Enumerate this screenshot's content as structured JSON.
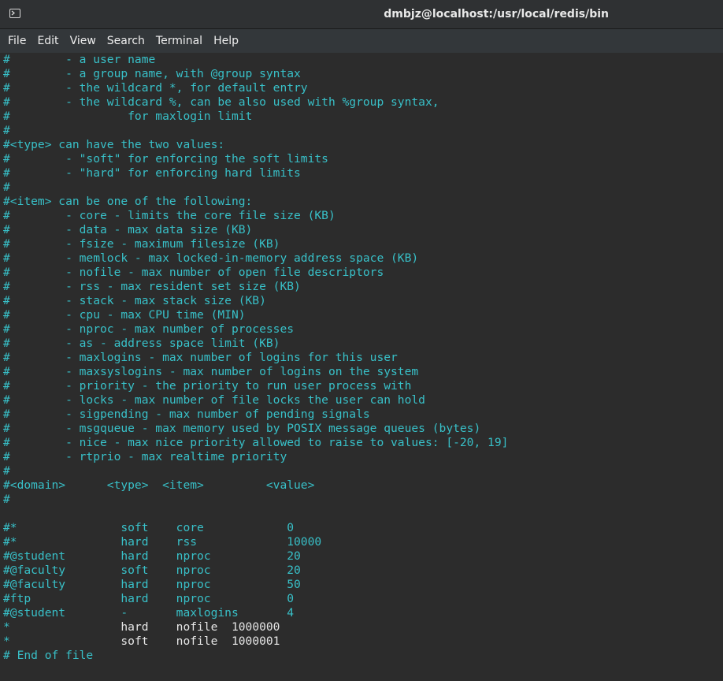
{
  "window": {
    "title": "dmbjz@localhost:/usr/local/redis/bin",
    "icon": "terminal-icon"
  },
  "menu": [
    {
      "label": "File"
    },
    {
      "label": "Edit"
    },
    {
      "label": "View"
    },
    {
      "label": "Search"
    },
    {
      "label": "Terminal"
    },
    {
      "label": "Help"
    }
  ],
  "colors": {
    "comment": "#38c0c8",
    "text": "#e6e6e6",
    "background": "#2c2c2c"
  },
  "terminal": {
    "lines": [
      "#        - a user name",
      "#        - a group name, with @group syntax",
      "#        - the wildcard *, for default entry",
      "#        - the wildcard %, can be also used with %group syntax,",
      "#                 for maxlogin limit",
      "#",
      "#<type> can have the two values:",
      "#        - \"soft\" for enforcing the soft limits",
      "#        - \"hard\" for enforcing hard limits",
      "#",
      "#<item> can be one of the following:",
      "#        - core - limits the core file size (KB)",
      "#        - data - max data size (KB)",
      "#        - fsize - maximum filesize (KB)",
      "#        - memlock - max locked-in-memory address space (KB)",
      "#        - nofile - max number of open file descriptors",
      "#        - rss - max resident set size (KB)",
      "#        - stack - max stack size (KB)",
      "#        - cpu - max CPU time (MIN)",
      "#        - nproc - max number of processes",
      "#        - as - address space limit (KB)",
      "#        - maxlogins - max number of logins for this user",
      "#        - maxsyslogins - max number of logins on the system",
      "#        - priority - the priority to run user process with",
      "#        - locks - max number of file locks the user can hold",
      "#        - sigpending - max number of pending signals",
      "#        - msgqueue - max memory used by POSIX message queues (bytes)",
      "#        - nice - max nice priority allowed to raise to values: [-20, 19]",
      "#        - rtprio - max realtime priority",
      "#",
      "#<domain>      <type>  <item>         <value>",
      "#",
      "",
      "#*               soft    core            0",
      "#*               hard    rss             10000",
      "#@student        hard    nproc           20",
      "#@faculty        soft    nproc           20",
      "#@faculty        hard    nproc           50",
      "#ftp             hard    nproc           0",
      "#@student        -       maxlogins       4",
      "*                hard    nofile  1000000",
      "*                soft    nofile  1000001",
      "# End of file"
    ]
  }
}
